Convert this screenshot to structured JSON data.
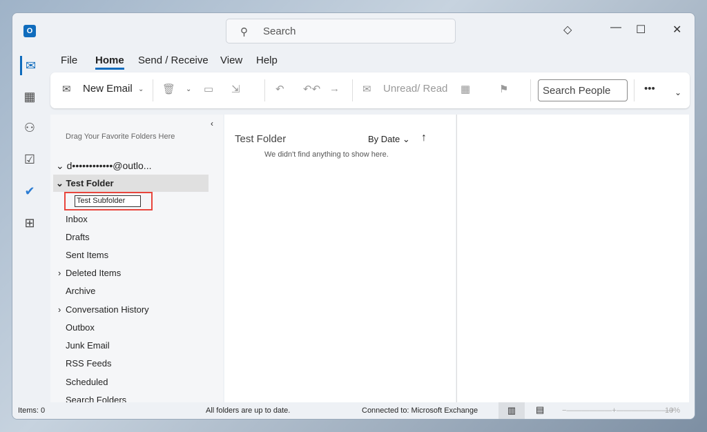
{
  "title_bar": {
    "search_placeholder": "Search"
  },
  "menu": [
    "File",
    "Home",
    "Send / Receive",
    "View",
    "Help"
  ],
  "ribbon": {
    "new_email": "New Email",
    "unread_read": "Unread/ Read",
    "search_people": "Search People",
    "more": "•••"
  },
  "folders": {
    "favorites_hint": "Drag Your Favorite Folders Here",
    "account": "d••••••••••••@outlo...",
    "selected": "Test Folder",
    "rename_value": "Test Subfolder",
    "items": [
      "Inbox",
      "Drafts",
      "Sent Items",
      "Deleted Items",
      "Archive",
      "Conversation History",
      "Outbox",
      "Junk Email",
      "RSS Feeds",
      "Scheduled",
      "Search Folders"
    ]
  },
  "message_list": {
    "folder_name": "Test Folder",
    "sort": "By Date",
    "empty": "We didn't find anything to show here."
  },
  "status": {
    "items": "Items: 0",
    "sync": "All folders are up to date.",
    "connection": "Connected to: Microsoft Exchange",
    "zoom": "10%"
  },
  "colors": {
    "accent": "#0f6cbd",
    "rename_highlight": "#e8453c"
  }
}
